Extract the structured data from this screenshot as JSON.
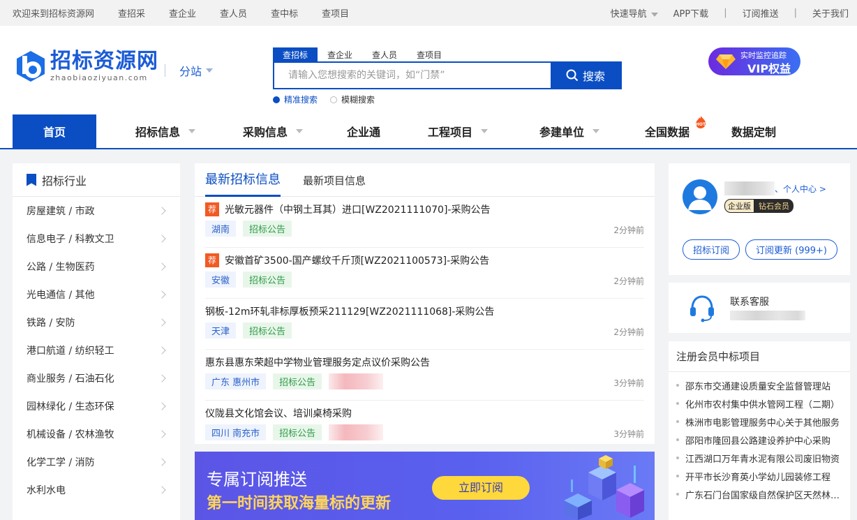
{
  "topbar": {
    "welcome": "欢迎来到招标资源网",
    "links": [
      "查招采",
      "查企业",
      "查人员",
      "查中标",
      "查项目"
    ],
    "quick_nav": "快速导航",
    "app_download": "APP下载",
    "subscribe_push": "订阅推送",
    "about": "关于我们",
    "separator": "|"
  },
  "header": {
    "logo_cn": "招标资源网",
    "logo_en": "zhaobiaoziyuan.com",
    "substation": "分站",
    "search_tabs": [
      "查招标",
      "查企业",
      "查人员",
      "查项目"
    ],
    "search_placeholder": "请输入您想搜索的关键词，如“门禁”",
    "search_button": "搜索",
    "exact_search": "精准搜索",
    "fuzzy_search": "模糊搜索",
    "vip_line1": "实时监控追踪",
    "vip_line2": "VIP权益"
  },
  "nav": {
    "items": [
      {
        "label": "首页"
      },
      {
        "label": "招标信息"
      },
      {
        "label": "采购信息"
      },
      {
        "label": "企业通"
      },
      {
        "label": "工程项目"
      },
      {
        "label": "参建单位"
      },
      {
        "label": "全国数据"
      },
      {
        "label": "数据定制"
      }
    ],
    "hot_badge": "HOT"
  },
  "industries": {
    "title": "招标行业",
    "items": [
      "房屋建筑 / 市政",
      "信息电子 / 科教文卫",
      "公路 / 生物医药",
      "光电通信 / 其他",
      "铁路 / 安防",
      "港口航道 / 纺织轻工",
      "商业服务 / 石油石化",
      "园林绿化 / 生态环保",
      "机械设备 / 农林渔牧",
      "化学工学 / 消防",
      "水利水电"
    ]
  },
  "listings": {
    "tab_active": "最新招标信息",
    "tab_other": "最新项目信息",
    "recommend_badge": "荐",
    "items": [
      {
        "title": "光敏元器件（中钢土耳其）进口[WZ2021111070]-采购公告",
        "region": "湖南",
        "type": "招标公告",
        "time": "2分钟前"
      },
      {
        "title": "安徽首矿3500-国产螺纹千斤顶[WZ2021100573]-采购公告",
        "region": "安徽",
        "type": "招标公告",
        "time": "2分钟前"
      },
      {
        "title": "钢板-12m环轧非标厚板预采211129[WZ2021111068]-采购公告",
        "region": "天津",
        "type": "招标公告",
        "time": "2分钟前"
      },
      {
        "title": "惠东县惠东荣超中学物业管理服务定点议价采购公告",
        "region": "广东 惠州市",
        "type": "招标公告",
        "time": "3分钟前"
      },
      {
        "title": "仪陇县文化馆会议、培训桌椅采购",
        "region": "四川 南充市",
        "type": "招标公告",
        "time": "3分钟前"
      }
    ]
  },
  "banner": {
    "line1": "专属订阅推送",
    "line2": "第一时间获取海量标的更新",
    "button": "立即订阅"
  },
  "user": {
    "center_link": "、个人中心 >",
    "enterprise_badge": "企业版",
    "diamond_badge": "钻石会员",
    "btn_subscribe": "招标订阅",
    "btn_updates": "订阅更新 (999+)"
  },
  "service": {
    "label": "联系客服"
  },
  "wins": {
    "title": "注册会员中标项目",
    "items": [
      "邵东市交通建设质量安全监督管理站",
      "化州市农村集中供水管网工程（二期）",
      "株洲市电影管理服务中心关于其他服务",
      "邵阳市隆回县公路建设养护中心采购",
      "江西湖口万年青水泥有限公司废旧物资",
      "开平市长沙育英小学幼儿园装修工程",
      "广东石门台国家级自然保护区天然林保护"
    ]
  },
  "colors": {
    "brand_blue": "#0b4ec3",
    "recommend_orange": "#f15a24",
    "banner_purple": "#5b55e6",
    "banner_yellow": "#ffd55a"
  }
}
